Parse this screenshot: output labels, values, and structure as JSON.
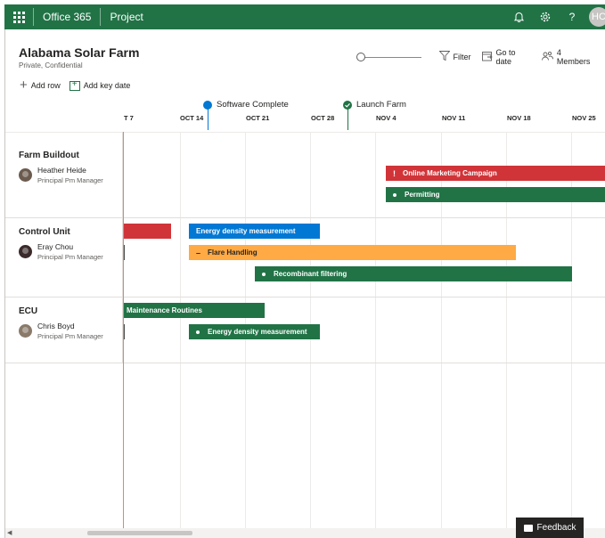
{
  "suite": {
    "app_name": "Office 365",
    "module": "Project",
    "avatar_initials": "HC",
    "accent": "#217346"
  },
  "project": {
    "title": "Alabama Solar Farm",
    "subtitle": "Private, Confidential"
  },
  "toolbar": {
    "add_row": "Add row",
    "add_key_date": "Add key date",
    "filter": "Filter",
    "go_to_date": "Go to date",
    "members": "4 Members"
  },
  "key_dates": [
    {
      "label": "Software Complete",
      "color": "#0078d4"
    },
    {
      "label": "Launch Farm",
      "color": "#217346"
    }
  ],
  "timeline": {
    "dates": [
      "T 7",
      "OCT 14",
      "OCT 21",
      "OCT 28",
      "NOV 4",
      "NOV 11",
      "NOV 18",
      "NOV 25"
    ]
  },
  "groups": [
    {
      "name": "Farm Buildout",
      "person": {
        "name": "Heather Heide",
        "role": "Principal Pm Manager",
        "avatar_color": "#6b5b4e"
      },
      "tasks": [
        {
          "label": "Online Marketing Campaign",
          "color": "#d13438",
          "marker": "!"
        },
        {
          "label": "Permitting",
          "color": "#217346",
          "marker": "dot"
        }
      ]
    },
    {
      "name": "Control Unit",
      "person": {
        "name": "Eray Chou",
        "role": "Principal Pm Manager",
        "avatar_color": "#3b2a2a"
      },
      "tasks": [
        {
          "label": "",
          "color": "#d13438",
          "marker": ""
        },
        {
          "label": "Energy density measurement",
          "color": "#0078d4",
          "marker": ""
        },
        {
          "label": "Flare Handling",
          "color": "#ffaa44",
          "marker": "–"
        },
        {
          "label": "Recombinant filtering",
          "color": "#217346",
          "marker": "dot"
        }
      ]
    },
    {
      "name": "ECU",
      "person": {
        "name": "Chris Boyd",
        "role": "Principal Pm Manager",
        "avatar_color": "#8a7a6a"
      },
      "tasks": [
        {
          "label": "Maintenance Routines",
          "color": "#217346",
          "marker": ""
        },
        {
          "label": "Energy density measurement",
          "color": "#217346",
          "marker": "dot"
        }
      ]
    }
  ],
  "today_color": "#e8826b",
  "feedback_label": "Feedback"
}
